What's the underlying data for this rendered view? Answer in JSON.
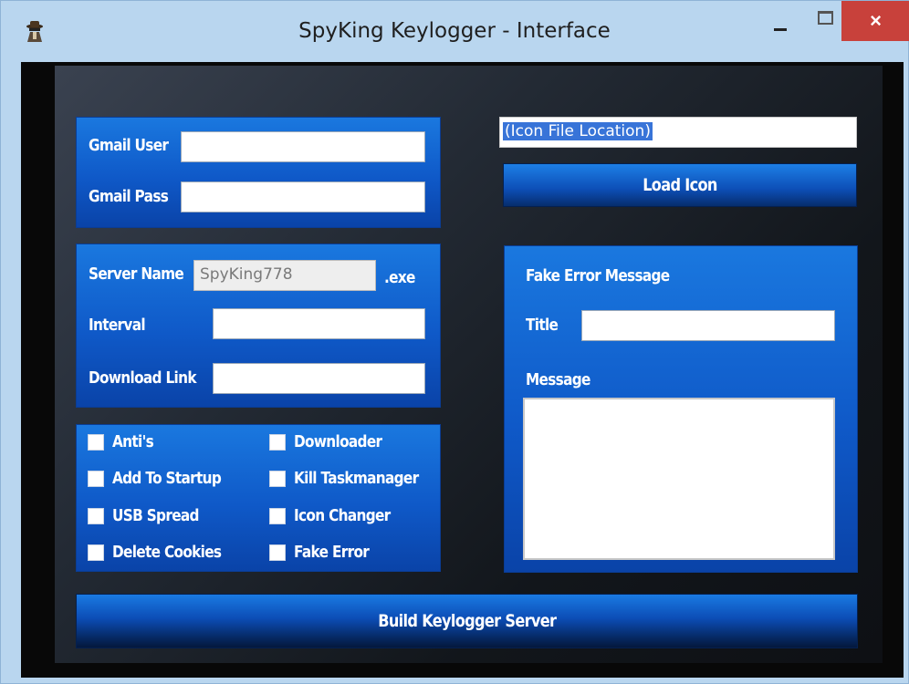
{
  "window": {
    "title": "SpyKing Keylogger - Interface",
    "close_glyph": "×"
  },
  "account": {
    "gmail_user_label": "Gmail User",
    "gmail_user_value": "",
    "gmail_pass_label": "Gmail Pass",
    "gmail_pass_value": ""
  },
  "server": {
    "server_name_label": "Server Name",
    "server_name_value": "SpyKing778",
    "extension": ".exe",
    "interval_label": "Interval",
    "interval_value": "",
    "download_link_label": "Download Link",
    "download_link_value": ""
  },
  "options": {
    "left": [
      "Anti's",
      "Add To Startup",
      "USB Spread",
      "Delete Cookies"
    ],
    "right": [
      "Downloader",
      "Kill Taskmanager",
      "Icon Changer",
      "Fake Error"
    ]
  },
  "icon": {
    "location_value": "(Icon File Location)",
    "load_button": "Load Icon"
  },
  "fake_error": {
    "heading": "Fake Error Message",
    "title_label": "Title",
    "title_value": "",
    "message_label": "Message",
    "message_value": ""
  },
  "build": {
    "button_label": "Build Keylogger Server"
  },
  "colors": {
    "titlebar": "#b9d6ef",
    "close_button": "#c8413b",
    "panel_blue": "#1466d4",
    "background_dark": "#080808"
  }
}
